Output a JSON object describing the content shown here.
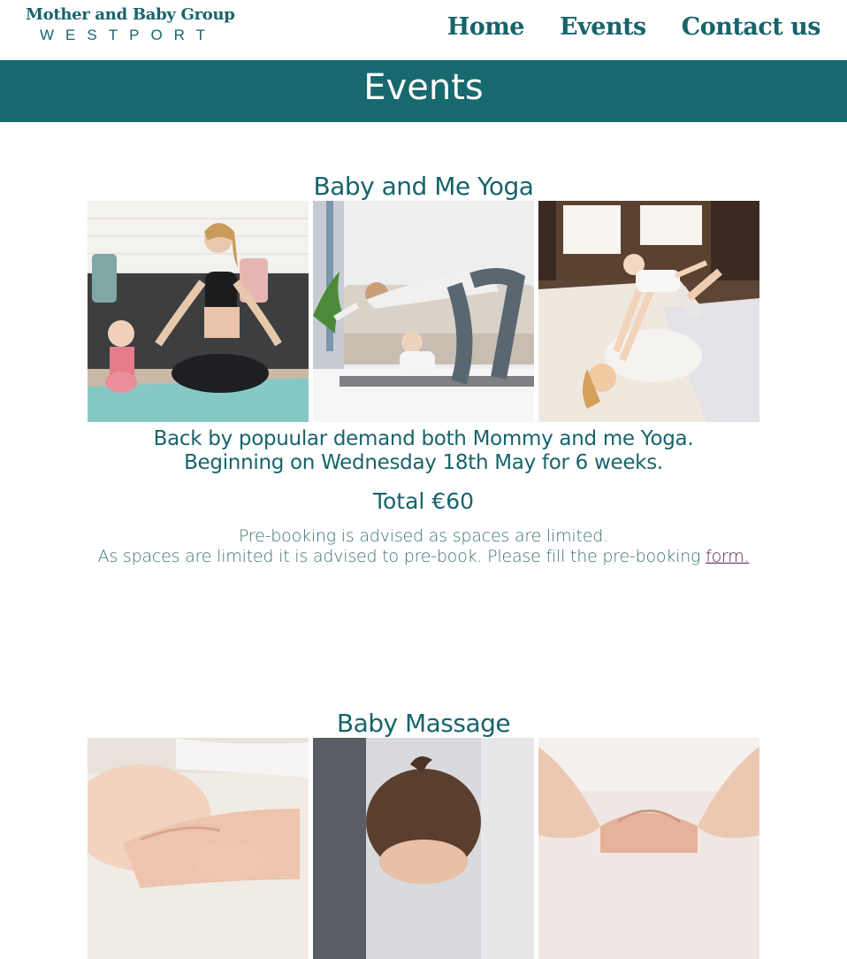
{
  "site": {
    "logo_title": "Mother and Baby Group",
    "logo_subtitle": "WESTPORT"
  },
  "nav": {
    "items": [
      {
        "label": "Home"
      },
      {
        "label": "Events"
      },
      {
        "label": "Contact us"
      }
    ]
  },
  "page": {
    "title": "Events"
  },
  "events": [
    {
      "title": "Baby and Me Yoga",
      "description_line1": "Back by popuular demand both Mommy and me Yoga.",
      "description_line2": "Beginning on Wednesday 18th May for 6 weeks.",
      "price": "Total €60",
      "note_line1": "Pre-booking is advised as spaces are limited.",
      "note_line2": "As spaces are limited it is advised to pre-book. Please fill the pre-booking ",
      "link_label": "form."
    },
    {
      "title": "Baby Massage"
    }
  ],
  "colors": {
    "brand": "#17696f",
    "text": "#17646b",
    "link_visited": "#5a1a4e",
    "background": "#ffffff"
  }
}
